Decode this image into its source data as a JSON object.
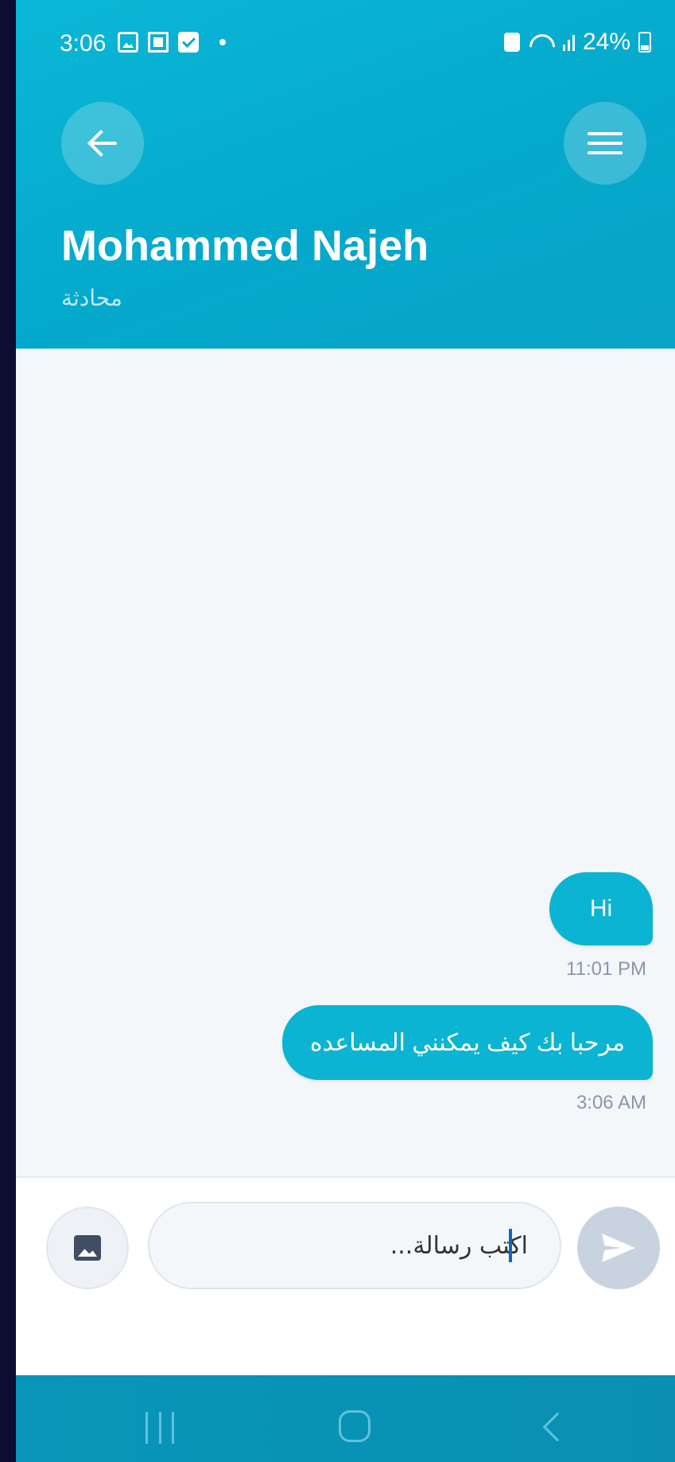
{
  "status_bar": {
    "time": "3:06",
    "battery_percent": "24%"
  },
  "header": {
    "contact_name": "Mohammed Najeh",
    "subtitle": "محادثة"
  },
  "messages": [
    {
      "text": "Hi",
      "time": "11:01 PM",
      "sender": "me"
    },
    {
      "text": "مرحبا بك كيف يمكنني المساعده",
      "time": "3:06 AM",
      "sender": "me"
    }
  ],
  "composer": {
    "placeholder": "اكتب رسالة..."
  },
  "colors": {
    "header": "#0bb7d6",
    "bubble": "#0bb4d3",
    "background": "#f4f7fa",
    "send_disabled": "#c9d3df"
  },
  "icons": [
    "back-arrow-icon",
    "menu-icon",
    "image-icon",
    "send-icon"
  ]
}
